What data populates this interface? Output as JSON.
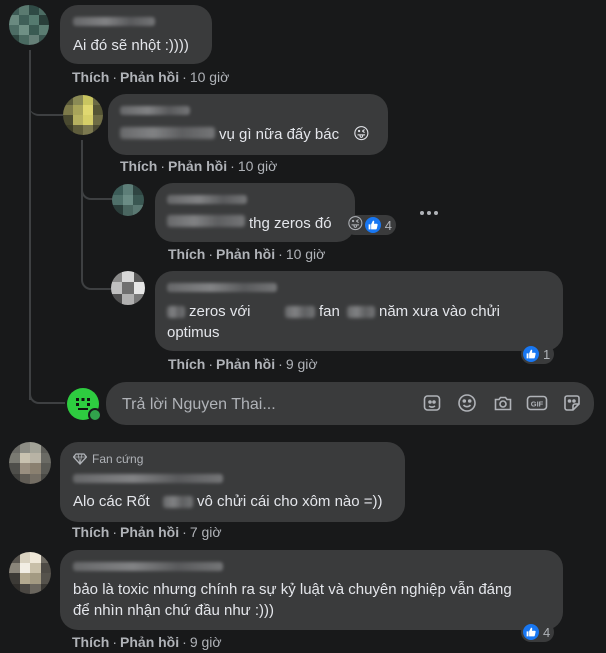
{
  "actions": {
    "like": "Thích",
    "reply": "Phản hồi",
    "sep": "·"
  },
  "comments": [
    {
      "text": "Ai đó sẽ nhột :))))",
      "time": "10 giờ"
    },
    {
      "text": "vụ gì nữa đấy bác",
      "emoji": "😜",
      "time": "10 giờ"
    },
    {
      "text": "thg zeros đó",
      "reaction_count": "4",
      "time": "10 giờ"
    },
    {
      "text_1": "zeros với",
      "text_2": "fan",
      "text_3": "năm xưa vào chửi",
      "text_line2": "optimus",
      "reaction_count": "1",
      "time": "9 giờ"
    },
    {
      "badge": "Fan cứng",
      "text_1": "Alo các Rốt",
      "text_2": "vô chửi cái cho xôm nào =))",
      "time": "7 giờ"
    },
    {
      "text_line1": "bảo là toxic nhưng chính ra sự kỷ luật và chuyên nghiệp vẫn đáng",
      "text_line2": "để nhìn nhận chứ đầu như :)))",
      "reaction_count": "4",
      "time": "9 giờ"
    }
  ],
  "reply_box": {
    "placeholder": "Trả lời Nguyen Thai..."
  },
  "icons": [
    "avatar-sticker-icon",
    "emoji-icon",
    "camera-icon",
    "gif-icon",
    "sticker-icon",
    "more-icon",
    "like-icon",
    "diamond-icon"
  ],
  "colors": {
    "background": "#18191a",
    "bubble": "#3a3b3c",
    "like_blue": "#1877f2",
    "avatar_green": "#2ecc40"
  }
}
